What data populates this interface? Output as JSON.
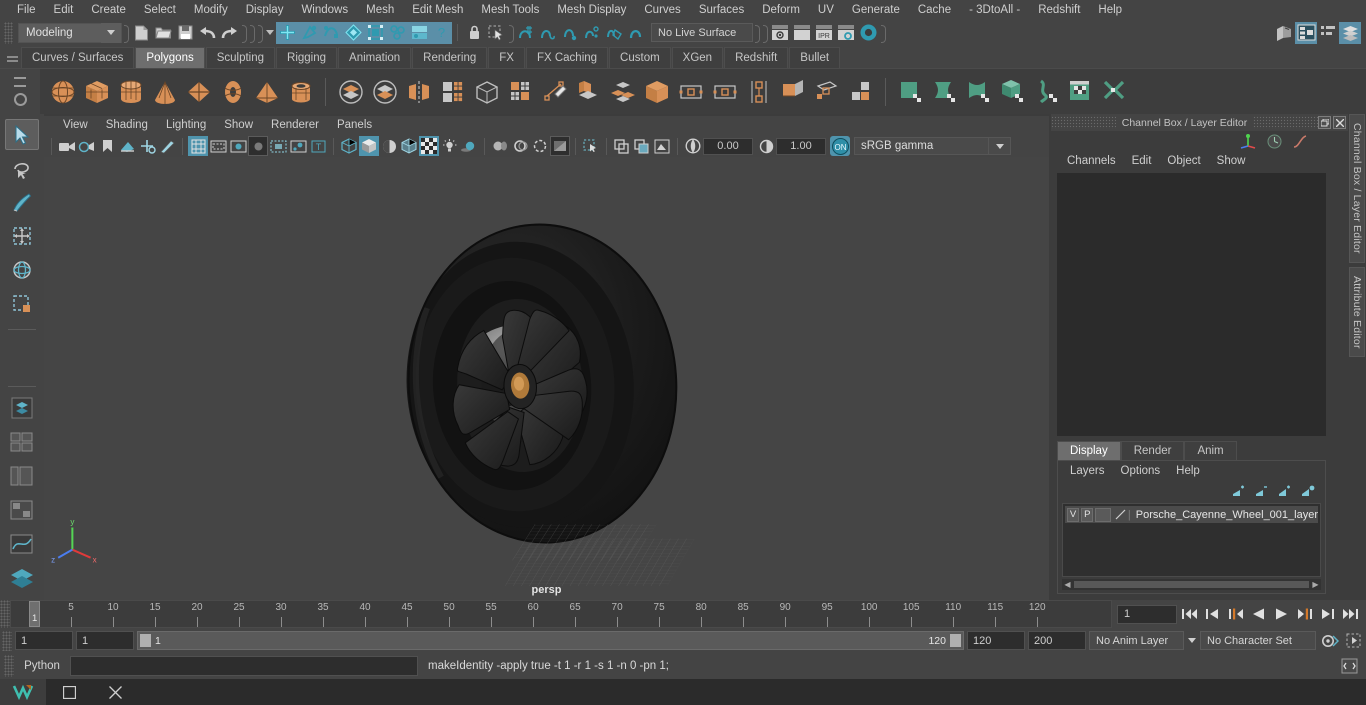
{
  "menubar": {
    "items": [
      "File",
      "Edit",
      "Create",
      "Select",
      "Modify",
      "Display",
      "Windows",
      "Mesh",
      "Edit Mesh",
      "Mesh Tools",
      "Mesh Display",
      "Curves",
      "Surfaces",
      "Deform",
      "UV",
      "Generate",
      "Cache",
      "- 3DtoAll -",
      "Redshift",
      "Help"
    ]
  },
  "statusline": {
    "mode": "Modeling",
    "live_surface": "No Live Surface"
  },
  "shelf": {
    "tabs": [
      "Curves / Surfaces",
      "Polygons",
      "Sculpting",
      "Rigging",
      "Animation",
      "Rendering",
      "FX",
      "FX Caching",
      "Custom",
      "XGen",
      "Redshift",
      "Bullet"
    ],
    "active_tab": "Polygons"
  },
  "viewport": {
    "menus": [
      "View",
      "Shading",
      "Lighting",
      "Show",
      "Renderer",
      "Panels"
    ],
    "exposure": "0.00",
    "gamma_value": "1.00",
    "color_profile": "sRGB gamma",
    "toggle_label": "ON",
    "camera_label": "persp"
  },
  "channelbox": {
    "panel_title": "Channel Box / Layer Editor",
    "menus": [
      "Channels",
      "Edit",
      "Object",
      "Show"
    ],
    "side_tabs": [
      "Channel Box / Layer Editor",
      "Attribute Editor"
    ],
    "restore_icon": "restore-icon",
    "close_icon": "close-icon"
  },
  "layereditor": {
    "tabs": [
      "Display",
      "Render",
      "Anim"
    ],
    "active_tab": "Display",
    "menus": [
      "Layers",
      "Options",
      "Help"
    ],
    "layers": [
      {
        "visible": "V",
        "playback": "P",
        "name": "Porsche_Cayenne_Wheel_001_layer"
      }
    ]
  },
  "timeslider": {
    "ticks": [
      5,
      10,
      15,
      20,
      25,
      30,
      35,
      40,
      45,
      50,
      55,
      60,
      65,
      70,
      75,
      80,
      85,
      90,
      95,
      100,
      105,
      110,
      115,
      120
    ],
    "current_frame_marker": "1",
    "current_frame_field": "1",
    "playback_buttons": [
      "go-to-start-icon",
      "step-back-keyframe-icon",
      "step-back-frame-icon",
      "play-backwards-icon",
      "play-forwards-icon",
      "step-forward-frame-icon",
      "step-forward-keyframe-icon",
      "go-to-end-icon"
    ]
  },
  "rangeslider": {
    "anim_start": "1",
    "range_start": "1",
    "bar_start": "1",
    "bar_end": "120",
    "range_end": "120",
    "anim_end": "200",
    "anim_layer": "No Anim Layer",
    "character_set": "No Character Set"
  },
  "commandline": {
    "language": "Python",
    "input_value": "",
    "output_text": "makeIdentity -apply true -t 1 -r 1 -s 1 -n 0 -pn 1;"
  },
  "taskbar": {
    "buttons": [
      "maya-app-icon",
      "window-icon",
      "close-icon"
    ]
  },
  "colors": {
    "accent_blue": "#4f94ad",
    "shelf_orange": "#d89057",
    "shelf_green": "#4f9e83",
    "panel_bg": "#3c3c3c",
    "menu_bg": "#444444"
  }
}
